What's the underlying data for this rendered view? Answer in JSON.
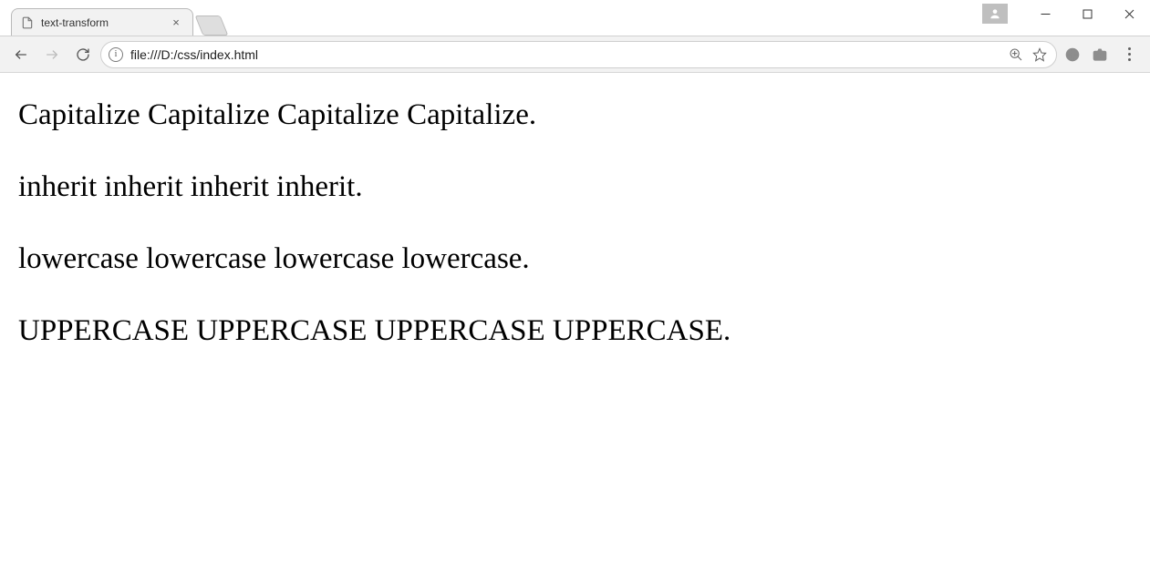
{
  "window": {
    "tab_title": "text-transform"
  },
  "toolbar": {
    "url": "file:///D:/css/index.html",
    "info_glyph": "i"
  },
  "page": {
    "lines": [
      "Capitalize Capitalize Capitalize Capitalize.",
      "inherit inherit inherit inherit.",
      "lowercase lowercase lowercase lowercase.",
      "UPPERCASE UPPERCASE UPPERCASE UPPERCASE."
    ]
  }
}
